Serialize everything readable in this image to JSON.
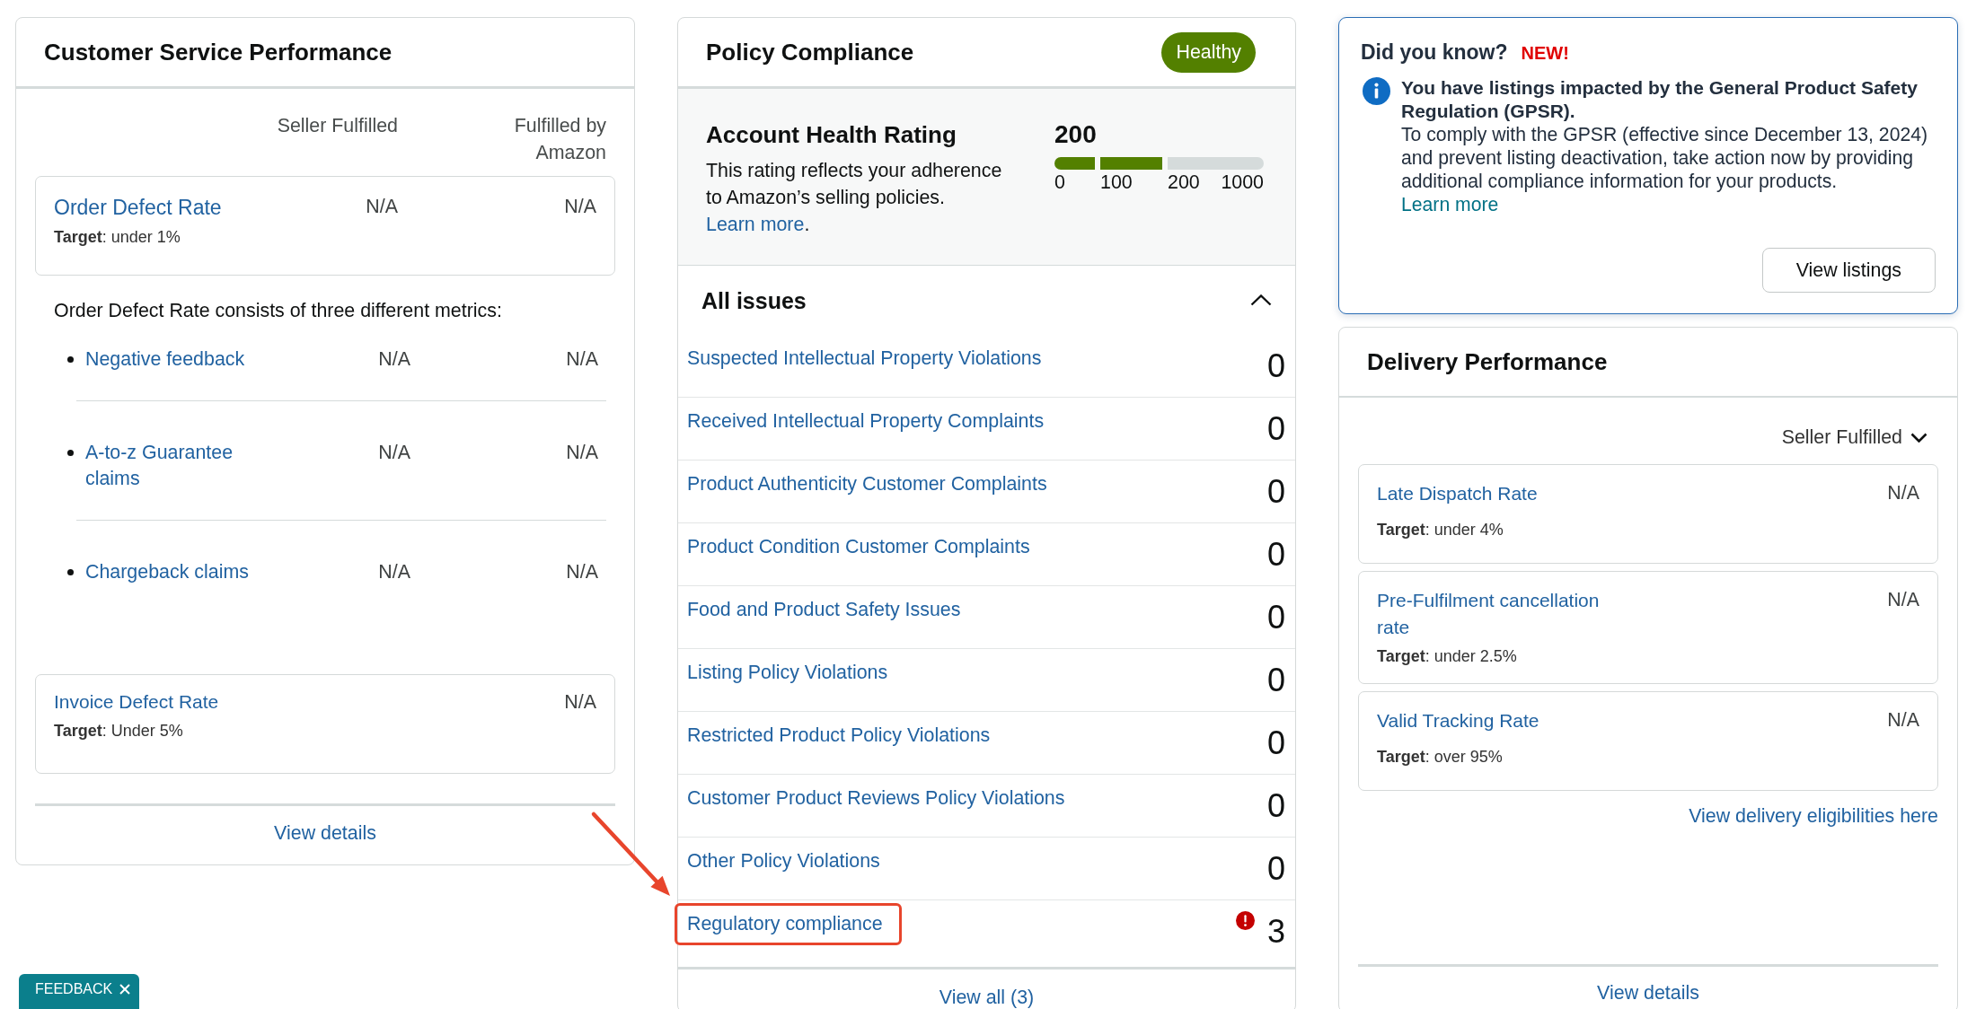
{
  "customer_service": {
    "title": "Customer Service Performance",
    "column_headers": [
      "Seller Fulfilled",
      "Fulfilled by Amazon"
    ],
    "order_defect_rate": {
      "title": "Order Defect Rate",
      "target": "**Target**: under 1%",
      "values": [
        "N/A",
        "N/A"
      ]
    },
    "breakdown_intro": "Order Defect Rate consists of three different metrics:",
    "metrics": [
      {
        "label": "Negative feedback",
        "values": [
          "N/A",
          "N/A"
        ]
      },
      {
        "label": "A-to-z Guarantee claims",
        "values": [
          "N/A",
          "N/A"
        ]
      },
      {
        "label": "Chargeback claims",
        "values": [
          "N/A",
          "N/A"
        ]
      }
    ],
    "invoice_defect_rate": {
      "title": "Invoice Defect Rate",
      "target": "**Target**: Under 5%",
      "values": [
        "N/A"
      ]
    },
    "footer_link": "View details"
  },
  "policy_compliance": {
    "title": "Policy Compliance",
    "status": "Healthy",
    "account_health": {
      "title": "Account Health Rating",
      "description": "This rating reflects your adherence to Amazon’s selling policies.",
      "link": "Learn more",
      "after_link": ".",
      "score": "200",
      "scale": [
        {
          "label": "0",
          "filled": true
        },
        {
          "label": "100",
          "filled": true
        },
        {
          "label": "200",
          "filled": false
        }
      ],
      "scale_end": "1000"
    },
    "issues": {
      "title": "All issues",
      "expanded": true,
      "items": [
        {
          "label": "Suspected Intellectual Property Violations",
          "count": "0",
          "alert": false,
          "highlighted": false
        },
        {
          "label": "Received Intellectual Property Complaints",
          "count": "0",
          "alert": false,
          "highlighted": false
        },
        {
          "label": "Product Authenticity Customer Complaints",
          "count": "0",
          "alert": false,
          "highlighted": false
        },
        {
          "label": "Product Condition Customer Complaints",
          "count": "0",
          "alert": false,
          "highlighted": false
        },
        {
          "label": "Food and Product Safety Issues",
          "count": "0",
          "alert": false,
          "highlighted": false
        },
        {
          "label": "Listing Policy Violations",
          "count": "0",
          "alert": false,
          "highlighted": false
        },
        {
          "label": "Restricted Product Policy Violations",
          "count": "0",
          "alert": false,
          "highlighted": false
        },
        {
          "label": "Customer Product Reviews Policy Violations",
          "count": "0",
          "alert": false,
          "highlighted": false
        },
        {
          "label": "Other Policy Violations",
          "count": "0",
          "alert": false,
          "highlighted": false
        },
        {
          "label": "Regulatory compliance",
          "count": "3",
          "alert": true,
          "highlighted": true
        }
      ]
    },
    "footer_link": "View all (3)"
  },
  "did_you_know": {
    "title": "Did you know?",
    "badge": "NEW!",
    "headline": "You have listings impacted by the General Product Safety Regulation (GPSR).",
    "body": "To comply with the GPSR (effective since December 13, 2024) and prevent listing deactivation, take action now by providing additional compliance information for your products.",
    "link": "Learn more",
    "button": "View listings"
  },
  "delivery_performance": {
    "title": "Delivery Performance",
    "filter": "Seller Fulfilled",
    "metrics": [
      {
        "title": "Late Dispatch Rate",
        "target": "**Target**: under 4%",
        "value": "N/A"
      },
      {
        "title": "Pre-Fulfilment cancellation rate",
        "target": "**Target**: under 2.5%",
        "value": "N/A"
      },
      {
        "title": "Valid Tracking Rate",
        "target": "**Target**: over 95%",
        "value": "N/A"
      }
    ],
    "eligibility_link": "View delivery eligibilities here",
    "footer_link": "View details"
  },
  "feedback_tab": {
    "label": "FEEDBACK"
  }
}
